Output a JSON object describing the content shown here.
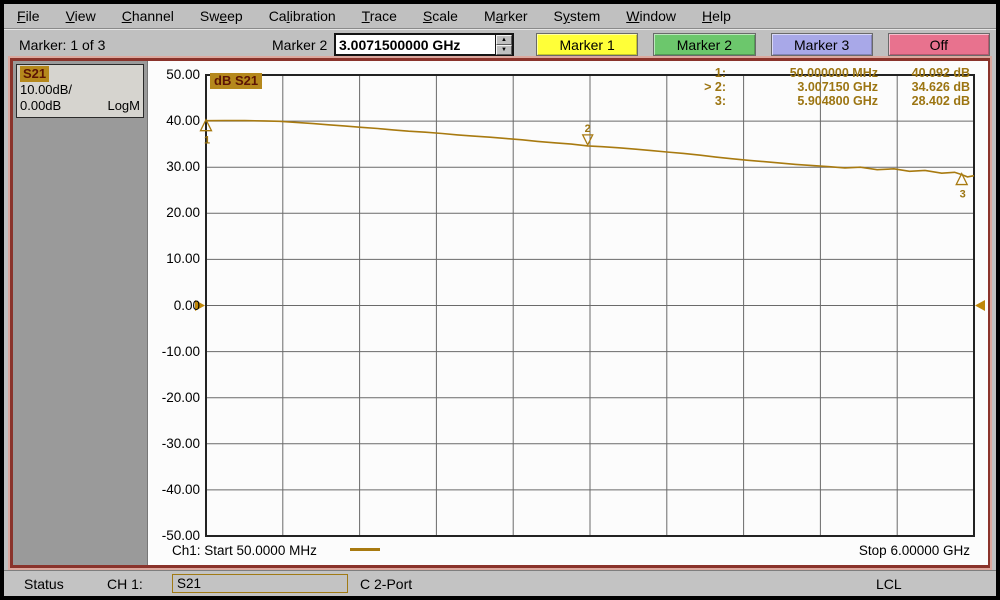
{
  "menubar": {
    "items": [
      {
        "label": "File",
        "underline": 0
      },
      {
        "label": "View",
        "underline": 0
      },
      {
        "label": "Channel",
        "underline": 0
      },
      {
        "label": "Sweep",
        "underline": 2
      },
      {
        "label": "Calibration",
        "underline": 2
      },
      {
        "label": "Trace",
        "underline": 0
      },
      {
        "label": "Scale",
        "underline": 0
      },
      {
        "label": "Marker",
        "underline": 1
      },
      {
        "label": "System",
        "underline": 1
      },
      {
        "label": "Window",
        "underline": 0
      },
      {
        "label": "Help",
        "underline": 0
      }
    ]
  },
  "toolbar": {
    "marker_status": "Marker: 1 of 3",
    "marker2_label": "Marker 2",
    "marker2_value": "3.0071500000 GHz",
    "spin_up_icon": "▲",
    "spin_down_icon": "▼",
    "marker_buttons": [
      {
        "label": "Marker 1",
        "color": "#ffff38"
      },
      {
        "label": "Marker 2",
        "color": "#6cc76c"
      },
      {
        "label": "Marker 3",
        "color": "#a8a8e8"
      },
      {
        "label": "Off",
        "color": "#e8728e"
      }
    ]
  },
  "sidebar": {
    "trace_name": "S21",
    "scale_per_div": "10.00dB/",
    "ref_level": "0.00dB",
    "format": "LogM"
  },
  "graph": {
    "trace_label": "dB S21"
  },
  "chart_data": {
    "type": "line",
    "title": "dB S21",
    "x_axis": {
      "start_ghz": 0.05,
      "stop_ghz": 6.0,
      "start_text": "Ch1: Start 50.0000 MHz",
      "stop_text": "Stop 6.00000 GHz"
    },
    "y_axis": {
      "unit": "dB",
      "min": -50,
      "max": 50,
      "scale_per_division": 10,
      "reference_level": 0,
      "ticks": [
        "50.00",
        "40.00",
        "30.00",
        "20.00",
        "10.00",
        "0.00",
        "-10.00",
        "-20.00",
        "-30.00",
        "-40.00",
        "-50.00"
      ]
    },
    "grid": {
      "x_divisions": 10,
      "y_divisions": 10,
      "visible": true
    },
    "series": [
      {
        "name": "S21",
        "format": "LogM",
        "color": "#a87a10",
        "points_ghz_db": [
          [
            0.05,
            40.09
          ],
          [
            0.2,
            40.12
          ],
          [
            0.35,
            40.1
          ],
          [
            0.5,
            40.05
          ],
          [
            0.62,
            39.95
          ],
          [
            0.75,
            39.72
          ],
          [
            0.88,
            39.45
          ],
          [
            1.0,
            39.2
          ],
          [
            1.12,
            38.95
          ],
          [
            1.25,
            38.65
          ],
          [
            1.38,
            38.4
          ],
          [
            1.5,
            38.1
          ],
          [
            1.62,
            37.8
          ],
          [
            1.75,
            37.6
          ],
          [
            1.88,
            37.3
          ],
          [
            2.0,
            37.0
          ],
          [
            2.12,
            36.75
          ],
          [
            2.25,
            36.5
          ],
          [
            2.38,
            36.2
          ],
          [
            2.5,
            35.95
          ],
          [
            2.62,
            35.6
          ],
          [
            2.75,
            35.3
          ],
          [
            2.88,
            35.0
          ],
          [
            3.007,
            34.63
          ],
          [
            3.12,
            34.45
          ],
          [
            3.25,
            34.2
          ],
          [
            3.38,
            33.9
          ],
          [
            3.5,
            33.6
          ],
          [
            3.62,
            33.3
          ],
          [
            3.75,
            33.0
          ],
          [
            3.88,
            32.6
          ],
          [
            4.0,
            32.2
          ],
          [
            4.12,
            31.85
          ],
          [
            4.25,
            31.5
          ],
          [
            4.38,
            31.2
          ],
          [
            4.5,
            30.9
          ],
          [
            4.62,
            30.6
          ],
          [
            4.75,
            30.35
          ],
          [
            4.88,
            30.1
          ],
          [
            5.0,
            29.85
          ],
          [
            5.12,
            30.0
          ],
          [
            5.25,
            29.45
          ],
          [
            5.38,
            29.65
          ],
          [
            5.5,
            29.1
          ],
          [
            5.62,
            29.3
          ],
          [
            5.75,
            28.7
          ],
          [
            5.85,
            28.9
          ],
          [
            5.9048,
            28.4
          ],
          [
            5.95,
            27.9
          ],
          [
            6.0,
            28.15
          ]
        ]
      }
    ],
    "markers": [
      {
        "id": "1",
        "freq_text": "50.000000 MHz",
        "value_text": "40.092 dB",
        "freq_ghz": 0.05,
        "db": 40.092,
        "active": false
      },
      {
        "id": "2",
        "freq_text": "3.007150 GHz",
        "value_text": "34.626 dB",
        "freq_ghz": 3.00715,
        "db": 34.626,
        "active": true
      },
      {
        "id": "3",
        "freq_text": "5.904800 GHz",
        "value_text": "28.402 dB",
        "freq_ghz": 5.9048,
        "db": 28.402,
        "active": false
      }
    ],
    "legend": "off"
  },
  "status_bar": {
    "status_label": "Status",
    "channel_label": "CH 1:",
    "measurement": "S21",
    "cal_status": "C  2-Port",
    "local_label": "LCL"
  },
  "colors": {
    "trace_amber": "#a87a10",
    "readout_amber": "#9c7512",
    "badge_bg": "#b5881c",
    "badge_text": "#5c1404",
    "window_frame": "#8a332b",
    "desktop_gray": "#c0c0c0",
    "grid_line": "#6a6a6a",
    "ref_marker": "#bf8708"
  }
}
